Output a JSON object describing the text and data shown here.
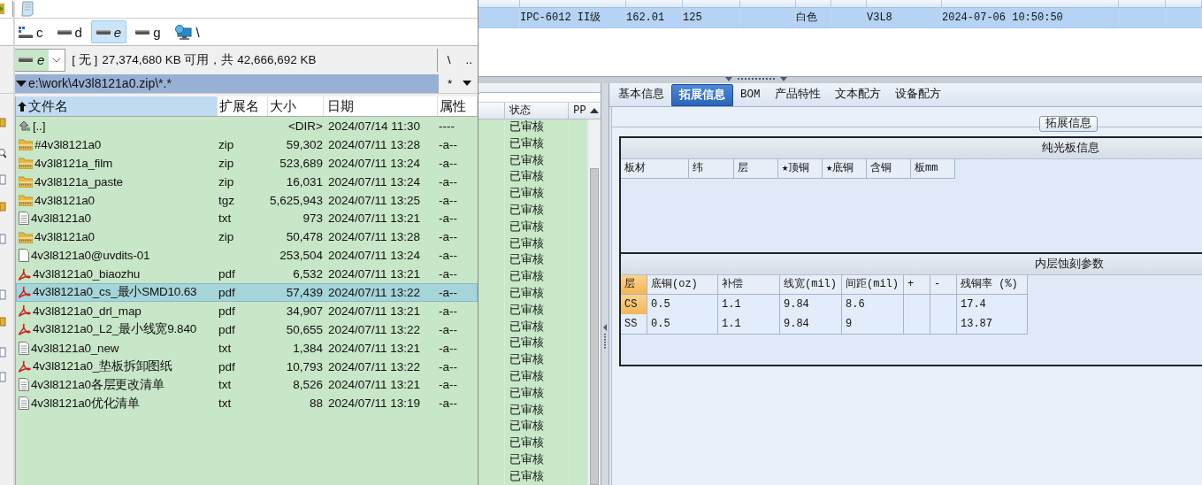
{
  "record_table": {
    "rows": [
      {
        "selected": true,
        "cells": [
          "IPC-6012 II级",
          "162.01",
          "125",
          "白色",
          "V3L8",
          "2024-07-06 10:50:50"
        ]
      }
    ]
  },
  "status_list": {
    "columns": [
      "状态",
      "PP"
    ],
    "rows": [
      "已审核",
      "已审核",
      "已审核",
      "已审核",
      "已审核",
      "已审核",
      "已审核",
      "已审核",
      "已审核",
      "已审核",
      "已审核",
      "已审核",
      "已审核",
      "已审核",
      "已审核",
      "已审核",
      "已审核",
      "已审核",
      "已审核",
      "已审核",
      "已审核",
      "已审核"
    ]
  },
  "tabs": [
    {
      "label": "基本信息",
      "selected": false
    },
    {
      "label": "拓展信息",
      "selected": true
    },
    {
      "label": "BOM",
      "selected": false
    },
    {
      "label": "产品特性",
      "selected": false
    },
    {
      "label": "文本配方",
      "selected": false
    },
    {
      "label": "设备配方",
      "selected": false
    }
  ],
  "group_title": "拓展信息",
  "sections": [
    {
      "title": "纯光板信息",
      "columns": [
        "板材",
        "纬",
        "层",
        "★顶铜",
        "★底铜",
        "含铜",
        "板mm"
      ]
    },
    {
      "title": "内层蚀刻参数",
      "columns": [
        "层",
        "底铜(oz)",
        "补偿",
        "线宽(mil)",
        "间距(mil)",
        "+",
        "-",
        "残铜率 (%)"
      ],
      "rows": [
        {
          "selected": true,
          "cells": [
            "CS",
            "0.5",
            "1.1",
            "9.84",
            "8.6",
            "17.4"
          ]
        },
        {
          "selected": false,
          "cells": [
            "SS",
            "0.5",
            "1.1",
            "9.84",
            "9",
            "13.87"
          ]
        }
      ]
    }
  ],
  "file_manager": {
    "drives": [
      {
        "letter": "c",
        "kind": "system",
        "selected": false
      },
      {
        "letter": "d",
        "kind": "disk",
        "selected": false
      },
      {
        "letter": "e",
        "kind": "disk",
        "selected": true
      },
      {
        "letter": "g",
        "kind": "disk",
        "selected": false
      },
      {
        "letter": "\\",
        "kind": "network",
        "selected": false
      }
    ],
    "drive_combo": "e",
    "volume_label": "[ 无 ]",
    "free_space": "27,374,680 KB 可用，共 42,666,692 KB",
    "root_button": "\\",
    "parent_button": "..",
    "path": "e:\\work\\4v3l8121a0.zip\\*.*",
    "filter_button": "*",
    "columns": [
      {
        "label": "文件名",
        "sorted": true
      },
      {
        "label": "扩展名",
        "sorted": false
      },
      {
        "label": "大小",
        "sorted": false
      },
      {
        "label": "日期",
        "sorted": false
      },
      {
        "label": "属性",
        "sorted": false
      }
    ],
    "files": [
      {
        "kind": "up",
        "name": "[..]",
        "size": "<DIR>",
        "date": "2024/07/14 11:30",
        "attr": "----",
        "selected": false
      },
      {
        "kind": "zip",
        "name": "#4v3l8121a0",
        "ext": "zip",
        "size": "59,302",
        "date": "2024/07/11 13:28",
        "attr": "-a--",
        "selected": false
      },
      {
        "kind": "zip",
        "name": "4v3l8121a_film",
        "ext": "zip",
        "size": "523,689",
        "date": "2024/07/11 13:24",
        "attr": "-a--",
        "selected": false
      },
      {
        "kind": "zip",
        "name": "4v3l8121a_paste",
        "ext": "zip",
        "size": "16,031",
        "date": "2024/07/11 13:24",
        "attr": "-a--",
        "selected": false
      },
      {
        "kind": "zip",
        "name": "4v3l8121a0",
        "ext": "tgz",
        "size": "5,625,943",
        "date": "2024/07/11 13:25",
        "attr": "-a--",
        "selected": false
      },
      {
        "kind": "txt",
        "name": "4v3l8121a0",
        "ext": "txt",
        "size": "973",
        "date": "2024/07/11 13:21",
        "attr": "-a--",
        "selected": false
      },
      {
        "kind": "zip",
        "name": "4v3l8121a0",
        "ext": "zip",
        "size": "50,478",
        "date": "2024/07/11 13:28",
        "attr": "-a--",
        "selected": false
      },
      {
        "kind": "file",
        "name": "4v3l8121a0@uvdits-01",
        "size": "253,504",
        "date": "2024/07/11 13:24",
        "attr": "-a--",
        "selected": false
      },
      {
        "kind": "pdf",
        "name": "4v3l8121a0_biaozhu",
        "ext": "pdf",
        "size": "6,532",
        "date": "2024/07/11 13:21",
        "attr": "-a--",
        "selected": false
      },
      {
        "kind": "pdf",
        "name": "4v3l8121a0_cs_最小SMD10.63",
        "ext": "pdf",
        "size": "57,439",
        "date": "2024/07/11 13:22",
        "attr": "-a--",
        "selected": true
      },
      {
        "kind": "pdf",
        "name": "4v3l8121a0_drl_map",
        "ext": "pdf",
        "size": "34,907",
        "date": "2024/07/11 13:21",
        "attr": "-a--",
        "selected": false
      },
      {
        "kind": "pdf",
        "name": "4v3l8121a0_L2_最小线宽9.840",
        "ext": "pdf",
        "size": "50,655",
        "date": "2024/07/11 13:22",
        "attr": "-a--",
        "selected": false
      },
      {
        "kind": "txt",
        "name": "4v3l8121a0_new",
        "ext": "txt",
        "size": "1,384",
        "date": "2024/07/11 13:21",
        "attr": "-a--",
        "selected": false
      },
      {
        "kind": "pdf",
        "name": "4v3l8121a0_垫板拆卸图纸",
        "ext": "pdf",
        "size": "10,793",
        "date": "2024/07/11 13:22",
        "attr": "-a--",
        "selected": false
      },
      {
        "kind": "txt",
        "name": "4v3l8121a0各层更改清单",
        "ext": "txt",
        "size": "8,526",
        "date": "2024/07/11 13:21",
        "attr": "-a--",
        "selected": false
      },
      {
        "kind": "txt",
        "name": "4v3l8121a0优化清单",
        "ext": "txt",
        "size": "88",
        "date": "2024/07/11 13:19",
        "attr": "-a--",
        "selected": false
      }
    ]
  }
}
